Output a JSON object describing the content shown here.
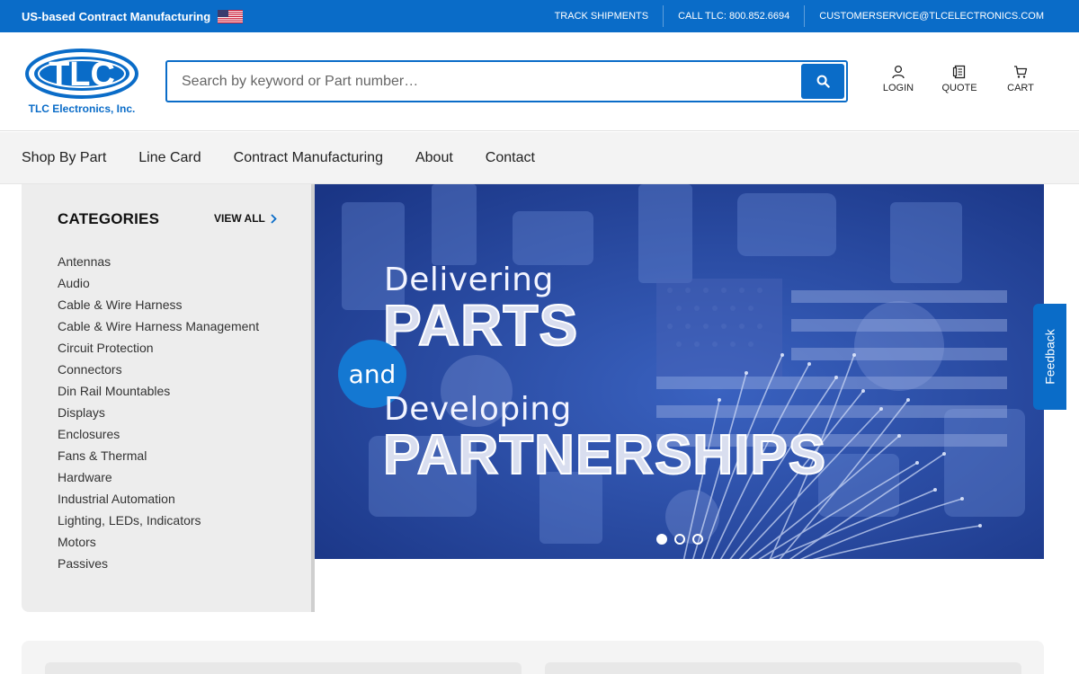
{
  "topbar": {
    "tagline": "US-based Contract Manufacturing",
    "links": [
      "TRACK SHIPMENTS",
      "CALL TLC: 800.852.6694",
      "CUSTOMERSERVICE@TLCELECTRONICS.COM"
    ]
  },
  "header": {
    "logo_text": "TLC",
    "logo_subtext": "TLC Electronics, Inc.",
    "search_placeholder": "Search by keyword or Part number…",
    "icons": [
      {
        "label": "LOGIN",
        "icon": "user-icon"
      },
      {
        "label": "QUOTE",
        "icon": "quote-icon"
      },
      {
        "label": "CART",
        "icon": "cart-icon"
      }
    ]
  },
  "nav": {
    "items": [
      "Shop By Part",
      "Line Card",
      "Contract Manufacturing",
      "About",
      "Contact"
    ]
  },
  "sidebar": {
    "title": "CATEGORIES",
    "view_all": "VIEW ALL",
    "categories": [
      "Antennas",
      "Audio",
      "Cable & Wire Harness",
      "Cable & Wire Harness Management",
      "Circuit Protection",
      "Connectors",
      "Din Rail Mountables",
      "Displays",
      "Enclosures",
      "Fans & Thermal",
      "Hardware",
      "Industrial Automation",
      "Lighting, LEDs, Indicators",
      "Motors",
      "Passives"
    ]
  },
  "hero": {
    "line1": "Delivering",
    "line2": "PARTS",
    "and": "and",
    "line3": "Developing",
    "line4": "PARTNERSHIPS",
    "slides": 3,
    "active_slide": 0
  },
  "feedback": {
    "label": "Feedback"
  },
  "colors": {
    "brand_blue": "#0a6cc8",
    "hero_blue": "#1f3f9a",
    "and_circle": "#1478d2"
  }
}
